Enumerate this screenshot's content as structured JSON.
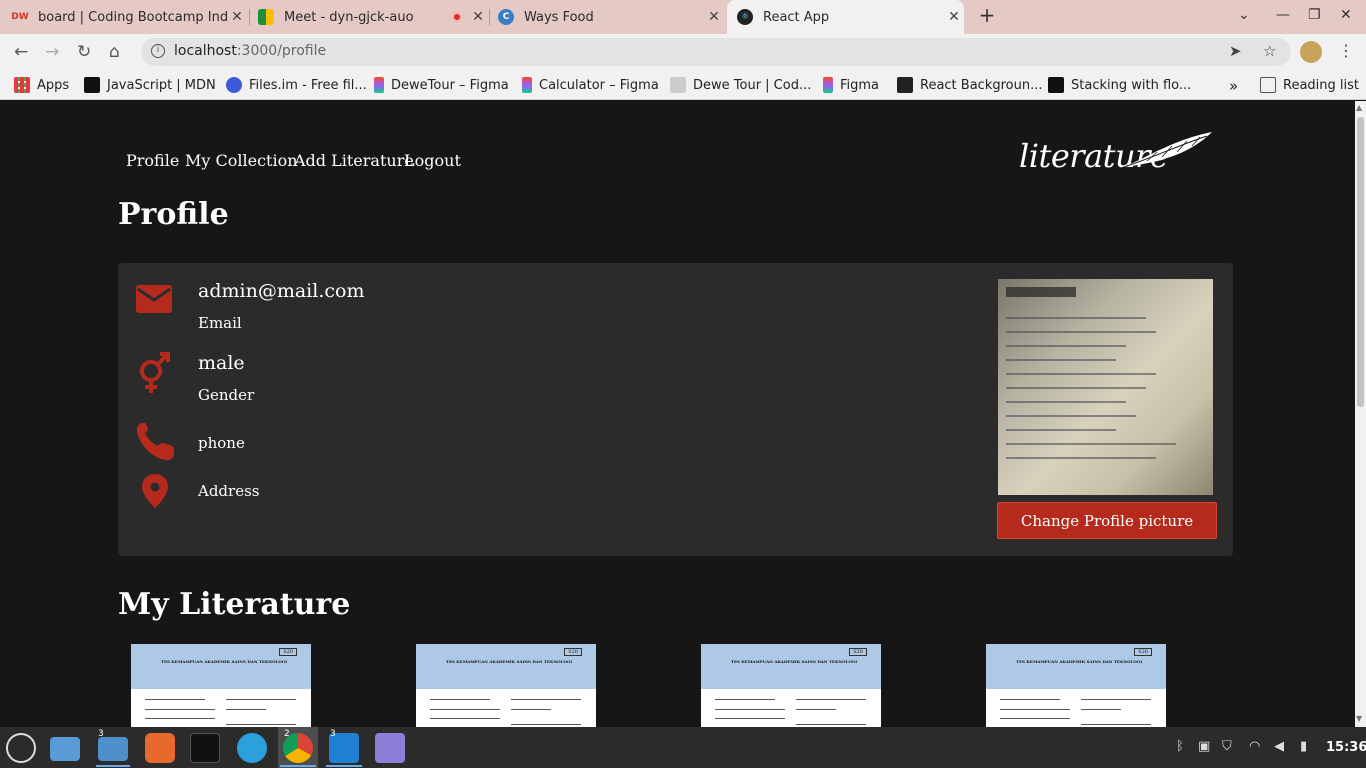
{
  "browser": {
    "tabs": [
      {
        "title": "board | Coding Bootcamp Ind",
        "favicon": "dumbways-icon"
      },
      {
        "title": "Meet - dyn-gjck-auo",
        "favicon": "meet-icon",
        "recording": true
      },
      {
        "title": "Ways Food",
        "favicon": "waysfood-icon"
      },
      {
        "title": "React App",
        "favicon": "react-icon",
        "active": true
      }
    ],
    "url_host": "localhost",
    "url_path": ":3000/profile",
    "bookmarks": [
      {
        "label": "Apps",
        "icon": "apps-grid-icon"
      },
      {
        "label": "JavaScript | MDN",
        "icon": "mdn-icon"
      },
      {
        "label": "Files.im - Free fil...",
        "icon": "files-icon"
      },
      {
        "label": "DeweTour – Figma",
        "icon": "figma-icon"
      },
      {
        "label": "Calculator – Figma",
        "icon": "figma-icon"
      },
      {
        "label": "Dewe Tour | Cod...",
        "icon": "dewetour-icon"
      },
      {
        "label": "Figma",
        "icon": "figma-icon"
      },
      {
        "label": "React Backgroun...",
        "icon": "react-bg-icon"
      },
      {
        "label": "Stacking with flo...",
        "icon": "stacking-icon"
      }
    ],
    "bookmarks_more": "»",
    "reading_list": "Reading list"
  },
  "app": {
    "nav": [
      "Profile",
      "My Collection",
      "Add Literature",
      "Logout"
    ],
    "brand": "literature",
    "page_title": "Profile",
    "profile": {
      "email_value": "admin@mail.com",
      "email_label": "Email",
      "gender_value": "male",
      "gender_label": "Gender",
      "phone_label": "phone",
      "address_label": "Address",
      "change_picture_label": "Change Profile picture"
    },
    "literature_title": "My Literature",
    "books": [
      {
        "code": "S20",
        "heading": "TES KEMAMPUAN AKADEMIK SAINS DAN TEKNOLOGI"
      },
      {
        "code": "S20",
        "heading": "TES KEMAMPUAN AKADEMIK SAINS DAN TEKNOLOGI"
      },
      {
        "code": "S20",
        "heading": "TES KEMAMPUAN AKADEMIK SAINS DAN TEKNOLOGI"
      },
      {
        "code": "S20",
        "heading": "TES KEMAMPUAN AKADEMIK SAINS DAN TEKNOLOGI"
      }
    ]
  },
  "taskbar": {
    "clock": "15:36",
    "files_badge": "3",
    "chrome_badge": "2",
    "vscode_badge": "3"
  },
  "colors": {
    "accent": "#b52a1c",
    "page_bg": "#161616",
    "card_bg": "#2b2b2b",
    "tabbar_bg": "#e4c9c5"
  }
}
